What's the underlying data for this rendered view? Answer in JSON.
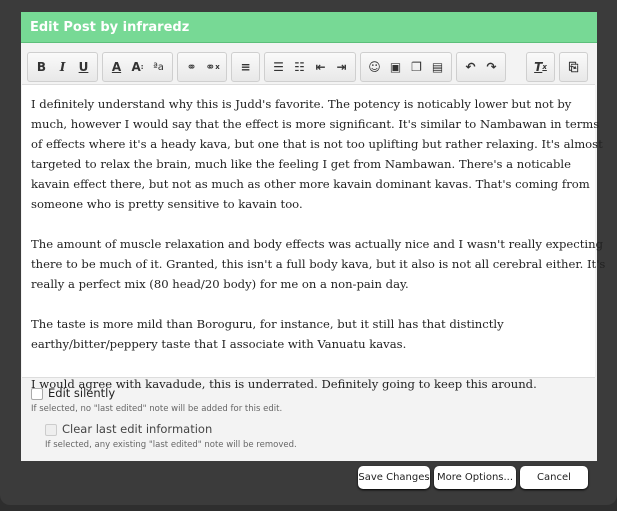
{
  "dialog": {
    "title": "Edit Post by infraredz"
  },
  "toolbar": {
    "groups": [
      [
        "B",
        "I",
        "U"
      ],
      [
        "A",
        "A:",
        "ªa"
      ],
      [
        "link",
        "unlink"
      ],
      [
        "align"
      ],
      [
        "ul",
        "ol",
        "outdent",
        "indent"
      ],
      [
        "smilie",
        "image",
        "media",
        "code"
      ],
      [
        "undo",
        "redo"
      ],
      [
        "removeformat"
      ],
      [
        "toggle-source"
      ]
    ]
  },
  "editor": {
    "paragraphs": [
      [
        "I definitely understand why this is Judd's favorite. The potency is noticably lower but not by",
        "much, however I would say that the effect is more significant. It's similar to Nambawan in terms",
        "of effects where it's a heady kava, but one that is not too uplifting but rather relaxing. It's almost",
        "targeted to relax the brain, much like the feeling I get from Nambawan. There's a noticable",
        "kavain effect there, but not as much as other more kavain dominant kavas. That's coming from",
        "someone who is pretty sensitive to kavain too."
      ],
      [
        "The amount of muscle relaxation and body effects was actually nice and I wasn't really expecting",
        "there to be much of it. Granted, this isn't a full body kava, but it also is not all cerebral either. It's",
        "really a perfect mix (80 head/20 body) for me on a non-pain day."
      ],
      [
        "The taste is more mild than Boroguru, for instance, but it still has that distinctly",
        "earthy/bitter/peppery taste that I associate with Vanuatu kavas."
      ],
      [
        "I would agree with kavadude, this is underrated. Definitely going to keep this around."
      ]
    ]
  },
  "options": {
    "silent_label": "Edit silently",
    "silent_hint": "If selected, no \"last edited\" note will be added for this edit.",
    "clear_label": "Clear last edit information",
    "clear_hint": "If selected, any existing \"last edited\" note will be removed."
  },
  "buttons": {
    "save": "Save Changes",
    "more": "More Options...",
    "cancel": "Cancel"
  },
  "colors": {
    "header": "#77d995"
  }
}
